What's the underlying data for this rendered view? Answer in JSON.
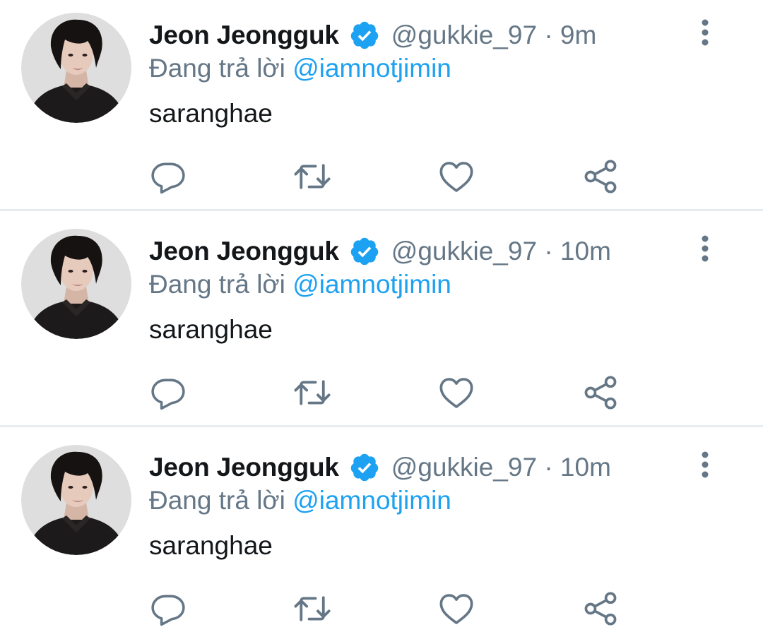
{
  "colors": {
    "text": "#14171a",
    "secondary": "#657786",
    "link": "#1da1f2",
    "divider": "#e6ecf0",
    "icon": "#657786"
  },
  "icons": {
    "verified": "verified-badge-icon",
    "more": "more-vertical-icon",
    "reply": "reply-icon",
    "retweet": "retweet-icon",
    "like": "heart-icon",
    "share": "share-icon"
  },
  "tweets": [
    {
      "author_name": "Jeon Jeongguk",
      "handle": "@gukkie_97",
      "separator": "·",
      "time": "9m",
      "reply_prefix": "Đang trả lời",
      "reply_mention": "@iamnotjimin",
      "text": "saranghae"
    },
    {
      "author_name": "Jeon Jeongguk",
      "handle": "@gukkie_97",
      "separator": "·",
      "time": "10m",
      "reply_prefix": "Đang trả lời",
      "reply_mention": "@iamnotjimin",
      "text": "saranghae"
    },
    {
      "author_name": "Jeon Jeongguk",
      "handle": "@gukkie_97",
      "separator": "·",
      "time": "10m",
      "reply_prefix": "Đang trả lời",
      "reply_mention": "@iamnotjimin",
      "text": "saranghae"
    }
  ]
}
